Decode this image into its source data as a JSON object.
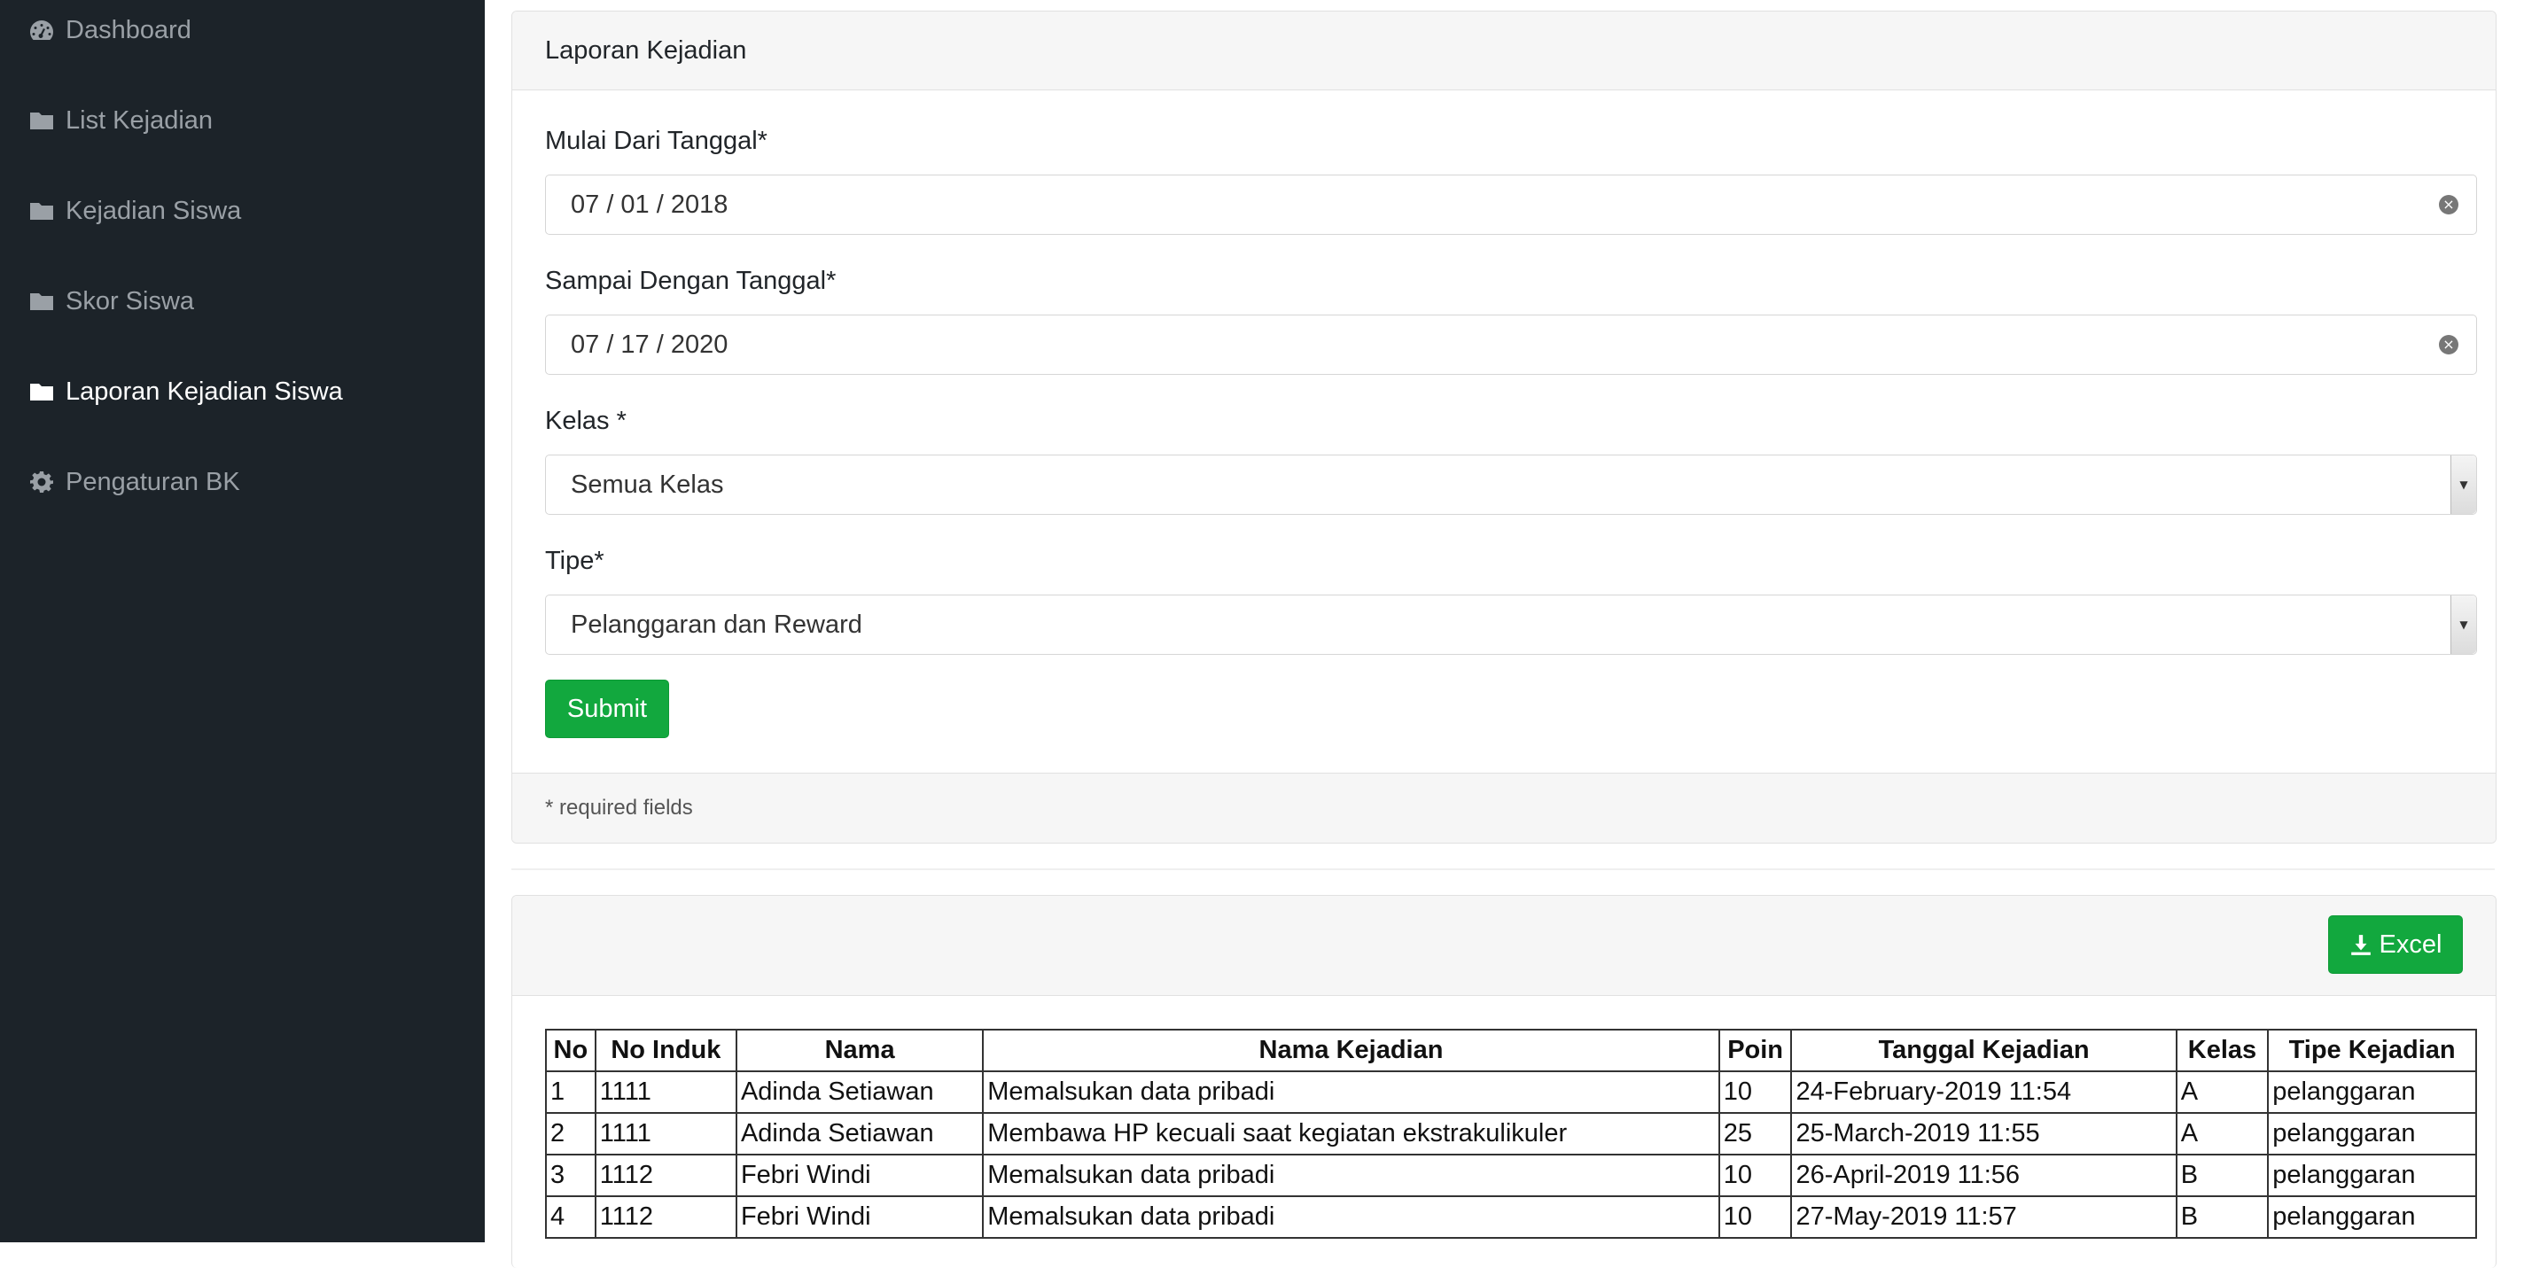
{
  "sidebar": {
    "items": [
      {
        "label": "Dashboard",
        "icon": "dashboard-icon"
      },
      {
        "label": "List Kejadian",
        "icon": "folder-icon"
      },
      {
        "label": "Kejadian Siswa",
        "icon": "folder-icon"
      },
      {
        "label": "Skor Siswa",
        "icon": "folder-icon"
      },
      {
        "label": "Laporan Kejadian Siswa",
        "icon": "folder-icon",
        "active": true
      },
      {
        "label": "Pengaturan BK",
        "icon": "gear-icon"
      }
    ]
  },
  "form_card": {
    "title": "Laporan Kejadian",
    "start_date": {
      "label": "Mulai Dari Tanggal*",
      "value": "07 / 01 / 2018"
    },
    "end_date": {
      "label": "Sampai Dengan Tanggal*",
      "value": "07 / 17 / 2020"
    },
    "kelas": {
      "label": "Kelas *",
      "value": "Semua Kelas"
    },
    "tipe": {
      "label": "Tipe*",
      "value": "Pelanggaran dan Reward"
    },
    "submit_label": "Submit",
    "footer_note": "* required fields"
  },
  "report_card": {
    "excel_label": "Excel",
    "columns": [
      "No",
      "No Induk",
      "Nama",
      "Nama Kejadian",
      "Poin",
      "Tanggal Kejadian",
      "Kelas",
      "Tipe Kejadian"
    ],
    "rows": [
      [
        "1",
        "1111",
        "Adinda Setiawan",
        "Memalsukan data pribadi",
        "10",
        "24-February-2019 11:54",
        "A",
        "pelanggaran"
      ],
      [
        "2",
        "1111",
        "Adinda Setiawan",
        "Membawa HP kecuali saat kegiatan ekstrakulikuler",
        "25",
        "25-March-2019 11:55",
        "A",
        "pelanggaran"
      ],
      [
        "3",
        "1112",
        "Febri Windi",
        "Memalsukan data pribadi",
        "10",
        "26-April-2019 11:56",
        "B",
        "pelanggaran"
      ],
      [
        "4",
        "1112",
        "Febri Windi",
        "Memalsukan data pribadi",
        "10",
        "27-May-2019 11:57",
        "B",
        "pelanggaran"
      ]
    ]
  },
  "colors": {
    "sidebar_bg": "#1c2329",
    "accent_green": "#12a83e"
  }
}
